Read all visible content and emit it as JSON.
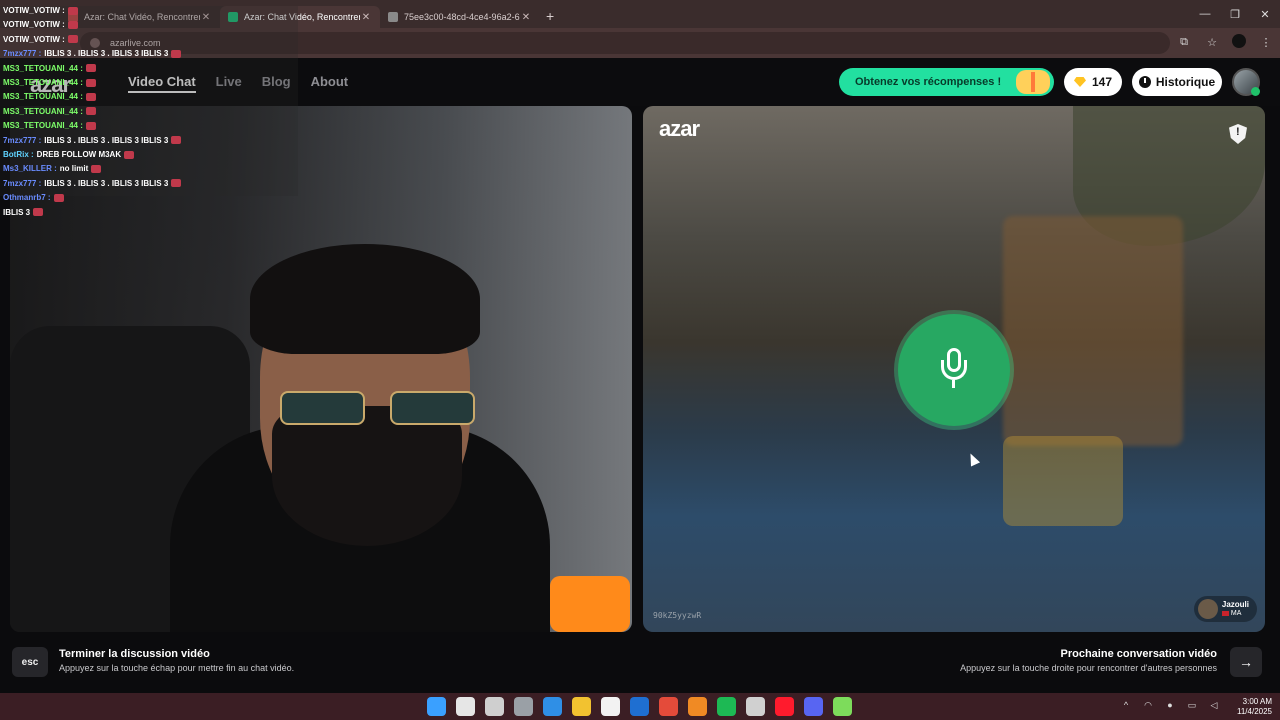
{
  "browser": {
    "tabs": [
      {
        "title": "Azar: Chat Vidéo, Rencontrer de",
        "favicon_color": "#c24a4a"
      },
      {
        "title": "Azar: Chat Vidéo, Rencontrer de",
        "favicon_color": "#1fbf7a"
      },
      {
        "title": "75ee3c00-48cd-4ce4-96a2-6b",
        "favicon_color": "#8a8a8a"
      }
    ],
    "url": "azarlive.com"
  },
  "site": {
    "logo": "azar",
    "nav": [
      "Video Chat",
      "Live",
      "Blog",
      "About"
    ],
    "rewards_label": "Obtenez vos récompenses !",
    "gems_count": "147",
    "history_label": "Historique"
  },
  "video": {
    "partner_logo": "azar",
    "session_id": "90kZ5yyzwR",
    "peer_name": "Jazouli",
    "peer_country": "MA"
  },
  "hints": {
    "esc_key": "esc",
    "end_title": "Terminer la discussion vidéo",
    "end_sub": "Appuyez sur la touche échap pour mettre fin au chat vidéo.",
    "next_title": "Prochaine conversation vidéo",
    "next_sub": "Appuyez sur la touche droite pour rencontrer d'autres personnes",
    "next_arrow": "→"
  },
  "chat": [
    {
      "user": "VOTIW_VOTIW :",
      "text": "",
      "color": "#ffffff"
    },
    {
      "user": "VOTIW_VOTIW :",
      "text": "",
      "color": "#ffffff"
    },
    {
      "user": "VOTIW_VOTIW :",
      "text": "",
      "color": "#ffffff"
    },
    {
      "user": "7mzx777 :",
      "text": "IBLIS 3 . IBLIS 3 . IBLIS 3 IBLIS 3",
      "color": "#6a8cff"
    },
    {
      "user": "MS3_TETOUANI_44 :",
      "text": "",
      "color": "#7dff6a"
    },
    {
      "user": "MS3_TETOUANI_44 :",
      "text": "",
      "color": "#7dff6a"
    },
    {
      "user": "MS3_TETOUANI_44 :",
      "text": "",
      "color": "#7dff6a"
    },
    {
      "user": "MS3_TETOUANI_44 :",
      "text": "",
      "color": "#7dff6a"
    },
    {
      "user": "MS3_TETOUANI_44 :",
      "text": "",
      "color": "#7dff6a"
    },
    {
      "user": "7mzx777 :",
      "text": "IBLIS 3 . IBLIS 3 . IBLIS 3 IBLIS 3",
      "color": "#6a8cff"
    },
    {
      "user": "BotRix :",
      "text": "DREB FOLLOW M3AK",
      "color": "#5fd3ff"
    },
    {
      "user": "Ms3_KILLER :",
      "text": "no limit",
      "color": "#6a8cff"
    },
    {
      "user": "7mzx777 :",
      "text": "IBLIS 3 . IBLIS 3 . IBLIS 3 IBLIS 3",
      "color": "#6a8cff"
    },
    {
      "user": "Othmanrb7 :",
      "text": "",
      "color": "#6a8cff"
    },
    {
      "user": "",
      "text": "IBLIS 3",
      "color": "#ffffff"
    }
  ],
  "taskbar": {
    "time": "3:00 AM",
    "date": "11/4/2025",
    "icons": [
      "windows-start-icon",
      "search-icon",
      "task-view-icon",
      "settings-icon",
      "edge-icon",
      "file-explorer-icon",
      "store-icon",
      "outlook-icon",
      "chrome-icon",
      "app-icon",
      "spotify-icon",
      "steam-icon",
      "opera-icon",
      "discord-icon",
      "terminal-icon"
    ]
  },
  "colors": {
    "accent": "#22e0a0",
    "mic_button": "#27a862"
  }
}
